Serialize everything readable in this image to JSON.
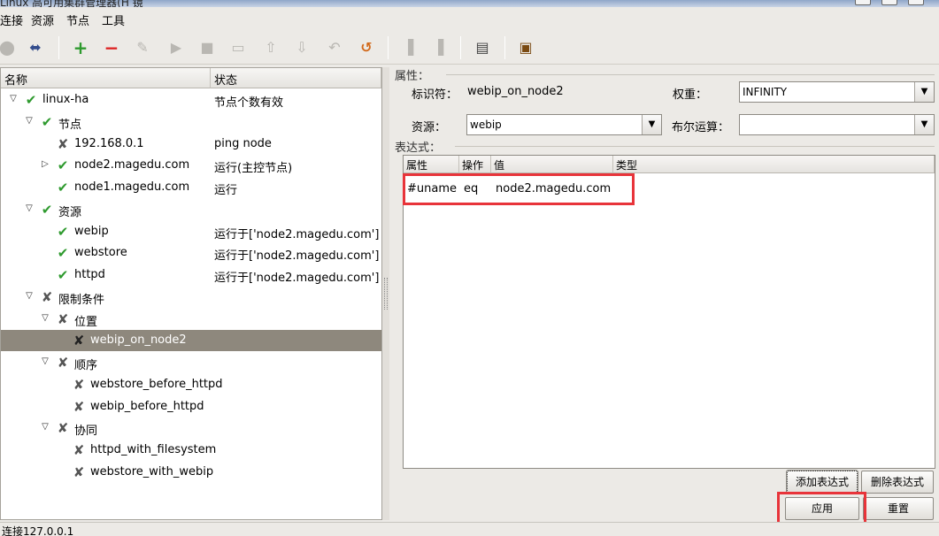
{
  "window": {
    "title": "Linux 高可用集群管理器(H 镜"
  },
  "menu": [
    "连接",
    "资源",
    "节点",
    "工具"
  ],
  "toolbar": {
    "icons": [
      "connect-icon",
      "disconnect-icon",
      "add-icon",
      "remove-icon",
      "cleanup-icon",
      "start-icon",
      "stop-icon",
      "default-icon",
      "move-up-icon",
      "move-down-icon",
      "undo-icon",
      "refresh-icon",
      "standby-icon",
      "active-icon",
      "log-icon",
      "exit-icon"
    ]
  },
  "tree": {
    "col_name": "名称",
    "col_status": "状态",
    "rows": [
      {
        "label": "linux-ha",
        "status": "节点个数有效",
        "icon": "check-icon",
        "expander": "open",
        "depth": 0
      },
      {
        "label": "节点",
        "status": "",
        "icon": "check-icon",
        "expander": "open",
        "depth": 1
      },
      {
        "label": "192.168.0.1",
        "status": "ping node",
        "icon": "tool-icon",
        "expander": "none",
        "depth": 2
      },
      {
        "label": "node2.magedu.com",
        "status": "运行(主控节点)",
        "icon": "check-icon",
        "expander": "closed",
        "depth": 2
      },
      {
        "label": "node1.magedu.com",
        "status": "运行",
        "icon": "check-icon",
        "expander": "none",
        "depth": 2
      },
      {
        "label": "资源",
        "status": "",
        "icon": "check-icon",
        "expander": "open",
        "depth": 1
      },
      {
        "label": "webip",
        "status": "运行于['node2.magedu.com']",
        "icon": "check-icon",
        "expander": "none",
        "depth": 2
      },
      {
        "label": "webstore",
        "status": "运行于['node2.magedu.com']",
        "icon": "check-icon",
        "expander": "none",
        "depth": 2
      },
      {
        "label": "httpd",
        "status": "运行于['node2.magedu.com']",
        "icon": "check-icon",
        "expander": "none",
        "depth": 2
      },
      {
        "label": "限制条件",
        "status": "",
        "icon": "tool-icon",
        "expander": "open",
        "depth": 1
      },
      {
        "label": "位置",
        "status": "",
        "icon": "tool-icon",
        "expander": "open",
        "depth": 2
      },
      {
        "label": "webip_on_node2",
        "status": "",
        "icon": "tool-icon",
        "expander": "none",
        "depth": 3,
        "selected": true
      },
      {
        "label": "顺序",
        "status": "",
        "icon": "tool-icon",
        "expander": "open",
        "depth": 2
      },
      {
        "label": "webstore_before_httpd",
        "status": "",
        "icon": "tool-icon",
        "expander": "none",
        "depth": 3
      },
      {
        "label": "webip_before_httpd",
        "status": "",
        "icon": "tool-icon",
        "expander": "none",
        "depth": 3
      },
      {
        "label": "协同",
        "status": "",
        "icon": "tool-icon",
        "expander": "open",
        "depth": 2
      },
      {
        "label": "httpd_with_filesystem",
        "status": "",
        "icon": "tool-icon",
        "expander": "none",
        "depth": 3
      },
      {
        "label": "webstore_with_webip",
        "status": "",
        "icon": "tool-icon",
        "expander": "none",
        "depth": 3
      }
    ]
  },
  "props": {
    "group_label": "属性：",
    "id_label": "标识符：",
    "id_value": "webip_on_node2",
    "weight_label": "权重：",
    "weight_value": "INFINITY",
    "resource_label": "资源：",
    "resource_value": "webip",
    "bool_label": "布尔运算：",
    "bool_value": ""
  },
  "expr": {
    "group_label": "表达式：",
    "columns": [
      "属性",
      "操作",
      "值",
      "类型"
    ],
    "row": {
      "attr": "#uname",
      "op": "eq",
      "value": "node2.magedu.com",
      "type": ""
    }
  },
  "buttons": {
    "add_expr": "添加表达式",
    "del_expr": "删除表达式",
    "apply": "应用",
    "reset": "重置"
  },
  "status": {
    "text": "连接127.0.0.1"
  },
  "colors": {
    "highlight": "#e8343a",
    "selected_row": "#8e887d",
    "ok_green": "#2e9a2e"
  }
}
